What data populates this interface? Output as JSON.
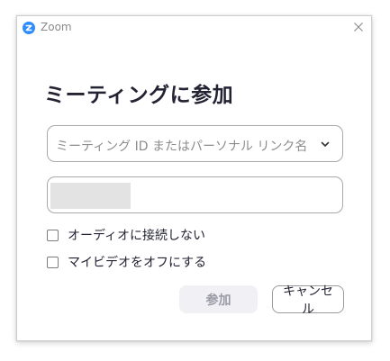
{
  "window": {
    "app_title": "Zoom",
    "app_icon": "zoom-logo-icon",
    "close_icon": "close-icon"
  },
  "dialog": {
    "title": "ミーティングに参加",
    "meeting_id_placeholder": "ミーティング ID またはパーソナル リンク名",
    "dropdown_icon": "chevron-down-icon",
    "name_field_value": "",
    "options": [
      {
        "label": "オーディオに接続しない",
        "checked": false
      },
      {
        "label": "マイビデオをオフにする",
        "checked": false
      }
    ],
    "join_label": "参加",
    "join_enabled": false,
    "cancel_label": "キャンセル"
  },
  "colors": {
    "brand": "#2d8cff",
    "title_text": "#232333",
    "disabled_button_bg": "#f0f0f5"
  }
}
